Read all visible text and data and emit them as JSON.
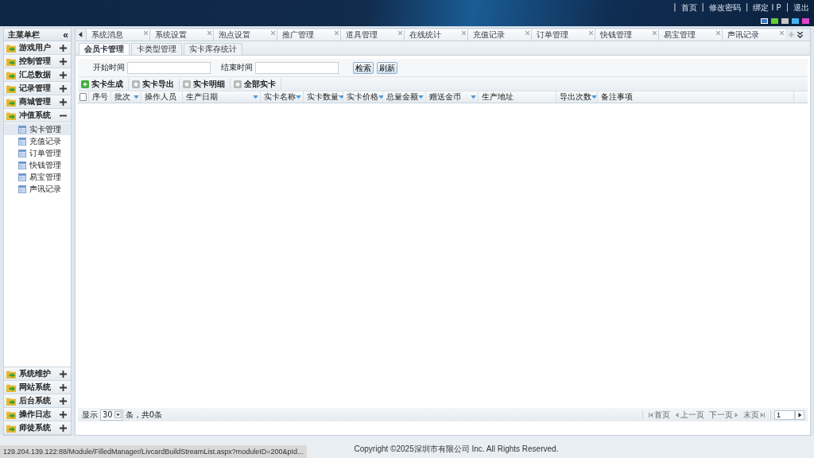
{
  "header": {
    "separator": "|",
    "links": [
      {
        "label": "首页"
      },
      {
        "label": "修改密码"
      },
      {
        "label": "绑定 I P"
      },
      {
        "label": "退出"
      }
    ],
    "themes": [
      {
        "color": "#3a78c8",
        "selected": true
      },
      {
        "color": "#66cc33",
        "selected": false
      },
      {
        "color": "#c8c8c8",
        "selected": false
      },
      {
        "color": "#44b4ee",
        "selected": false
      },
      {
        "color": "#dd44cc",
        "selected": false
      }
    ]
  },
  "sidebar": {
    "title": "主菜单栏",
    "collapse": "«",
    "groups": [
      {
        "label": "游戏用户",
        "expanded": false
      },
      {
        "label": "控制管理",
        "expanded": false
      },
      {
        "label": "汇总数据",
        "expanded": false
      },
      {
        "label": "记录管理",
        "expanded": false
      },
      {
        "label": "商城管理",
        "expanded": false
      },
      {
        "label": "冲值系统",
        "expanded": true,
        "children": [
          {
            "label": "实卡管理",
            "selected": true
          },
          {
            "label": "充值记录",
            "selected": false
          },
          {
            "label": "订单管理",
            "selected": false
          },
          {
            "label": "快钱管理",
            "selected": false
          },
          {
            "label": "易宝管理",
            "selected": false
          },
          {
            "label": "声讯记录",
            "selected": false
          }
        ]
      }
    ],
    "bottom_groups": [
      {
        "label": "系统维护",
        "expanded": false
      },
      {
        "label": "网站系统",
        "expanded": false
      },
      {
        "label": "后台系统",
        "expanded": false
      },
      {
        "label": "操作日志",
        "expanded": false
      },
      {
        "label": "师徒系统",
        "expanded": false
      }
    ]
  },
  "tabs": [
    {
      "label": "系统消息",
      "selected": false
    },
    {
      "label": "系统设置",
      "selected": false
    },
    {
      "label": "泡点设置",
      "selected": false
    },
    {
      "label": "推广管理",
      "selected": false
    },
    {
      "label": "道具管理",
      "selected": false
    },
    {
      "label": "在线统计",
      "selected": false
    },
    {
      "label": "充值记录",
      "selected": false
    },
    {
      "label": "订单管理",
      "selected": false
    },
    {
      "label": "快钱管理",
      "selected": false
    },
    {
      "label": "易宝管理",
      "selected": false
    },
    {
      "label": "声讯记录",
      "selected": false
    }
  ],
  "subtabs": [
    {
      "label": "会员卡管理",
      "selected": true
    },
    {
      "label": "卡类型管理",
      "selected": false
    },
    {
      "label": "实卡库存统计",
      "selected": false
    }
  ],
  "search": {
    "start_label": "开始时间",
    "end_label": "结束时间",
    "buttons": [
      "检索",
      "刷新"
    ]
  },
  "toolbar": [
    {
      "label": "实卡生成",
      "kind": "add"
    },
    {
      "label": "实卡导出",
      "kind": "plain"
    },
    {
      "label": "实卡明细",
      "kind": "plain"
    },
    {
      "label": "全部实卡",
      "kind": "plain"
    }
  ],
  "table": {
    "select_all_checked": false,
    "columns": [
      {
        "label": "序号",
        "filter": false
      },
      {
        "label": "批次",
        "filter": true
      },
      {
        "label": "操作人员",
        "filter": false
      },
      {
        "label": "生产日期",
        "filter": true
      },
      {
        "label": "实卡名称",
        "filter": true
      },
      {
        "label": "实卡数量",
        "filter": true
      },
      {
        "label": "实卡价格",
        "filter": true
      },
      {
        "label": "总量金额",
        "filter": true
      },
      {
        "label": "赠送金币",
        "filter": true
      },
      {
        "label": "生产地址",
        "filter": false
      },
      {
        "label": "导出次数",
        "filter": true
      },
      {
        "label": "备注事项",
        "filter": false
      }
    ]
  },
  "pager": {
    "show_label": "显示",
    "page_size": "30",
    "count_text": "条，共0条",
    "first": "首页",
    "prev": "上一页",
    "next": "下一页",
    "last": "末页",
    "page": "1"
  },
  "status_url": "129.204.139.122:88/Module/FilledManager/LivcardBuildStreamList.aspx?moduleID=200&pId...",
  "copyright": "Copyright ©2025深圳市有限公司 Inc. All Rights Reserved."
}
